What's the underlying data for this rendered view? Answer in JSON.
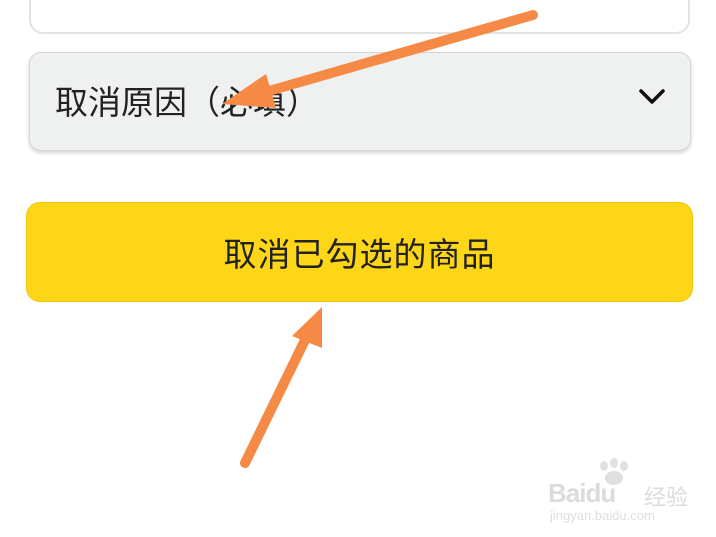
{
  "form": {
    "reason_select": {
      "placeholder": "取消原因（必填）",
      "icon": "chevron-down-icon"
    },
    "cancel_button": {
      "label": "取消已勾选的商品",
      "color": "#fdd618"
    }
  },
  "annotations": {
    "arrow_color": "#f58a46",
    "arrows": [
      "arrow-to-reason-select",
      "arrow-to-cancel-button"
    ]
  },
  "watermark": {
    "logo": "Bai",
    "logo_suffix": "du",
    "text": "经验",
    "url": "jingyan.baidu.com"
  }
}
